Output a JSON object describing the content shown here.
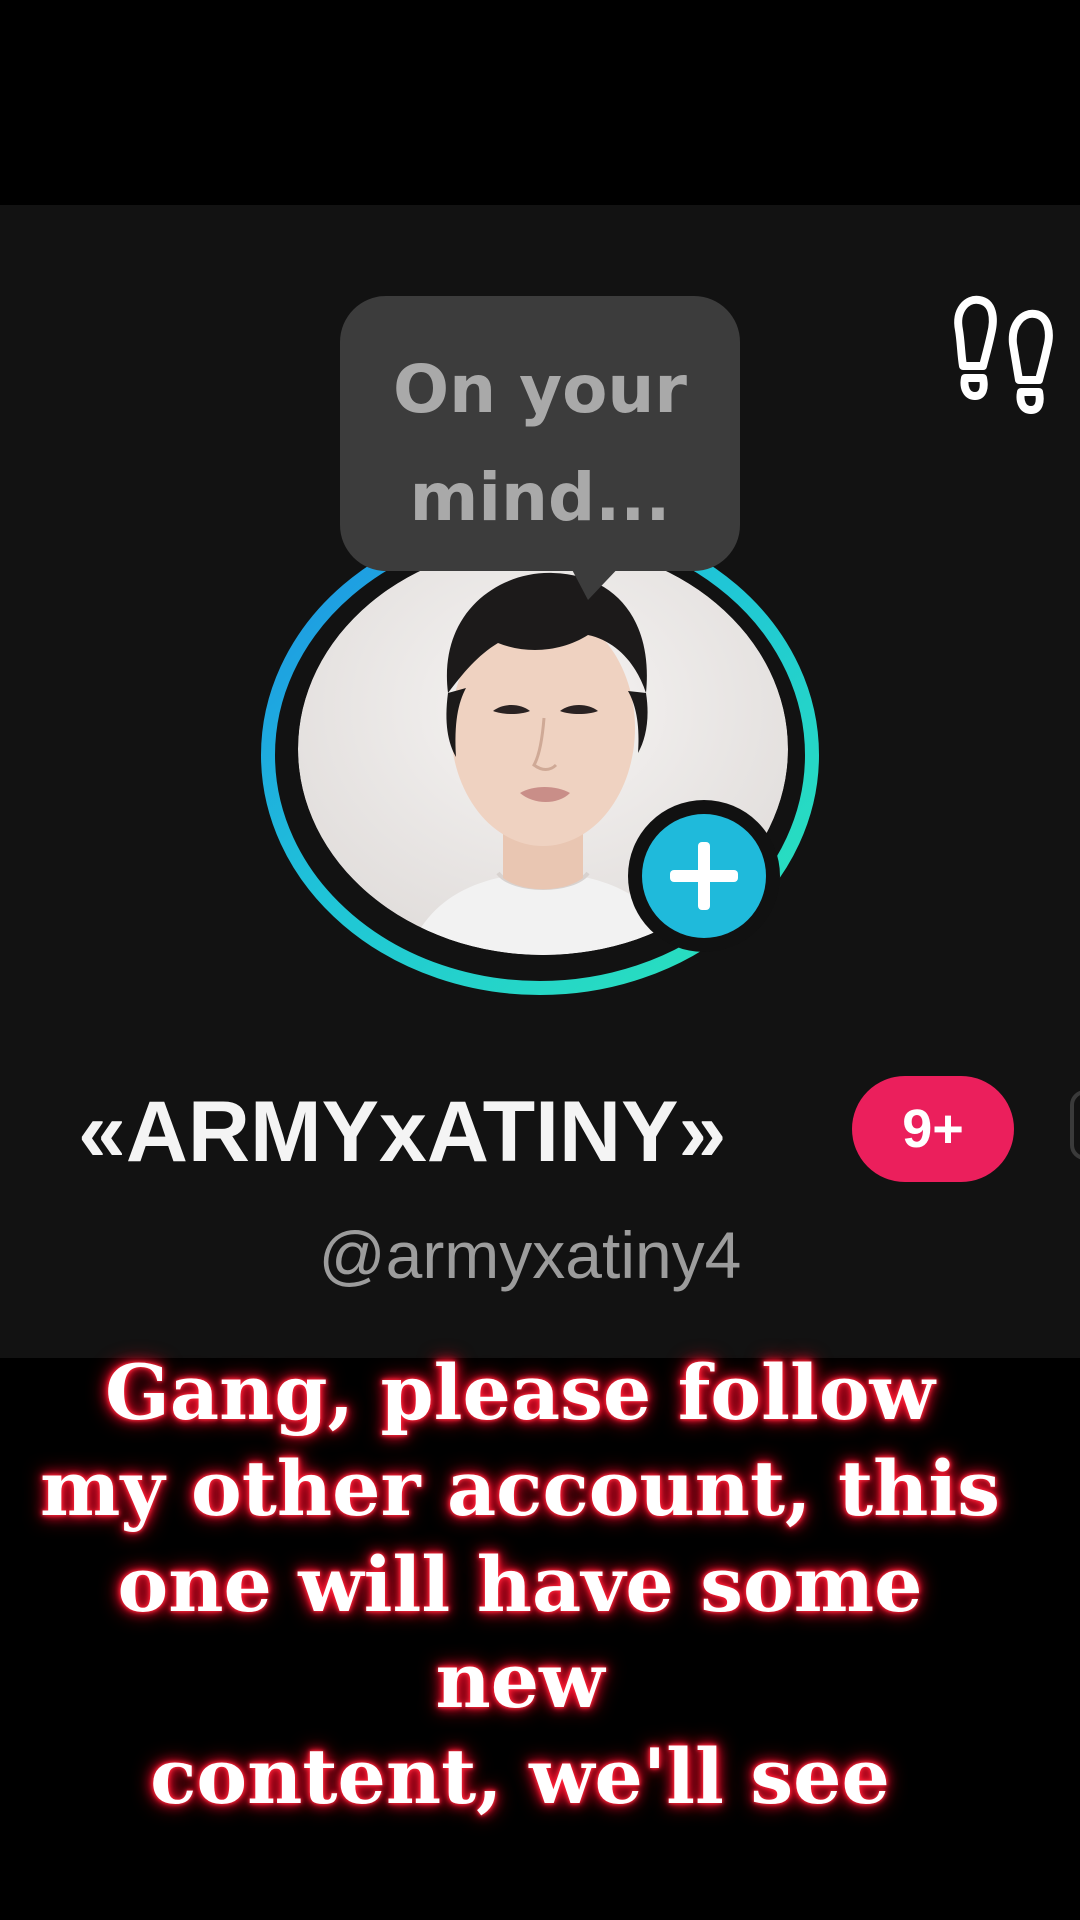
{
  "profile": {
    "note_bubble": "On your\nmind...",
    "display_name": "«ARMYxATINY»",
    "notification_badge": "9+",
    "username": "@armyxatiny4"
  },
  "caption": {
    "lines": [
      "Gang, please follow",
      "my other account, this",
      "one will have some new",
      "content, we'll see"
    ]
  },
  "icons": {
    "footprints": "footprints-icon",
    "add": "plus-icon",
    "avatar": "profile-photo"
  },
  "colors": {
    "background": "#000000",
    "panel": "#121212",
    "bubble": "#3c3c3c",
    "ring_start": "#1ea7e6",
    "ring_end": "#28e2c2",
    "add_button": "#1fbadb",
    "badge": "#eb1f5c",
    "caption_glow": "#ff1030"
  }
}
